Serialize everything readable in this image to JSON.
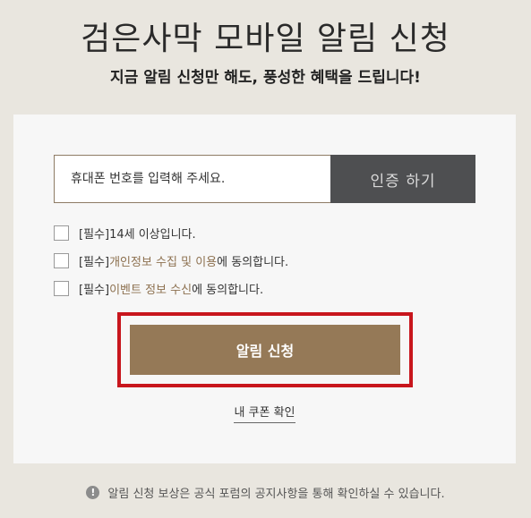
{
  "header": {
    "title": "검은사막 모바일 알림 신청",
    "subtitle": "지금 알림 신청만 해도, 풍성한 혜택을 드립니다!"
  },
  "form": {
    "phone_placeholder": "휴대폰 번호를 입력해 주세요.",
    "verify_label": "인증 하기",
    "agreements": [
      {
        "prefix": "[필수] ",
        "highlight": "",
        "text": "14세 이상입니다."
      },
      {
        "prefix": "[필수] ",
        "highlight": "개인정보 수집 및 이용",
        "text": "에 동의합니다."
      },
      {
        "prefix": "[필수] ",
        "highlight": "이벤트 정보 수신",
        "text": "에 동의합니다."
      }
    ],
    "submit_label": "알림 신청",
    "coupon_link": "내 쿠폰 확인"
  },
  "notice": {
    "icon": "info-icon",
    "icon_glyph": "!",
    "text": "알림 신청 보상은 공식 포럼의 공지사항을 통해 확인하실 수 있습니다."
  },
  "colors": {
    "accent": "#957957",
    "highlight": "#8d7150",
    "verify_bg": "#4e4f51",
    "focus_border": "#c8161d"
  }
}
